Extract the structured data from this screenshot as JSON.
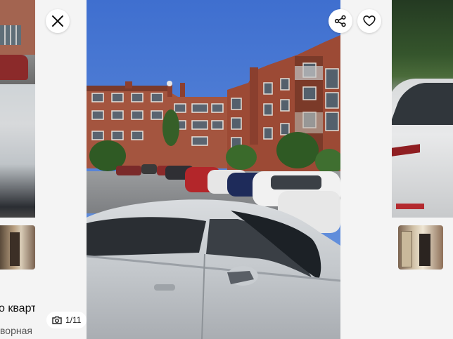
{
  "viewer": {
    "close_icon": "close-icon",
    "share_icon": "share-icon",
    "favorite_icon": "heart-icon",
    "camera_icon": "camera-icon",
    "photo_counter": "1/11"
  },
  "left_card": {
    "title": "о кварт",
    "subtitle": "ворная"
  },
  "right_card": {}
}
